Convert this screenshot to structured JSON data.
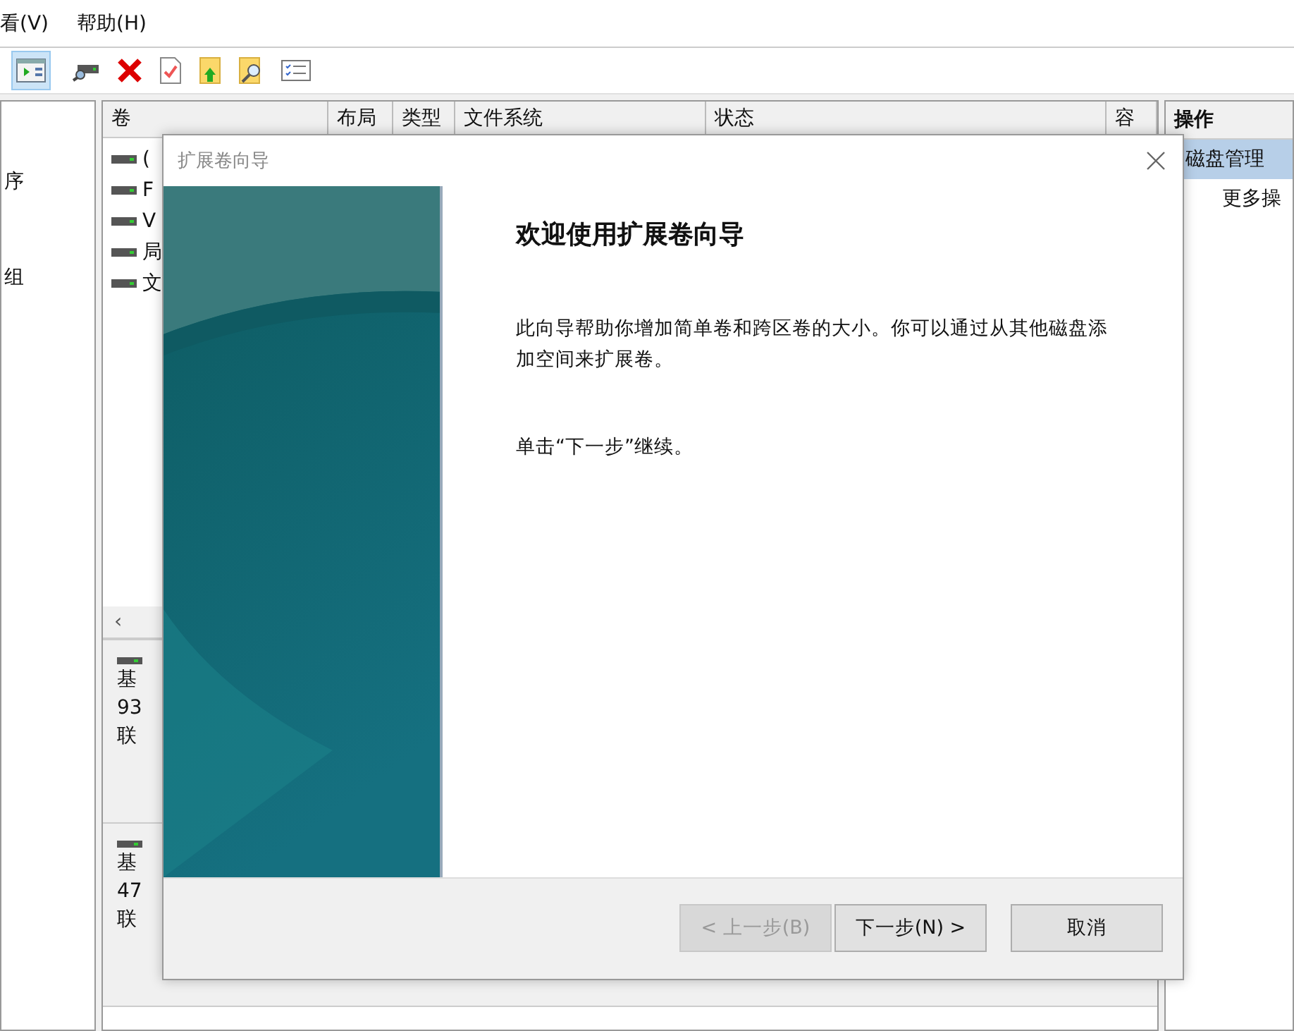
{
  "menu": [
    "看(V)",
    "帮助(H)"
  ],
  "toolbar": [
    {
      "kind": "view",
      "pressed": true
    },
    {
      "kind": "connect"
    },
    {
      "kind": "delete"
    },
    {
      "kind": "check"
    },
    {
      "kind": "up"
    },
    {
      "kind": "find"
    },
    {
      "kind": "list"
    }
  ],
  "scroll_left": "‹",
  "tree": [
    "序",
    "组"
  ],
  "table": {
    "columns": [
      "卷",
      "布局",
      "类型",
      "文件系统",
      "状态",
      "容"
    ],
    "rows": [
      {
        "label": "("
      },
      {
        "label": "F"
      },
      {
        "label": "V"
      },
      {
        "label": "局"
      },
      {
        "label": "文"
      }
    ]
  },
  "disks": [
    {
      "lines": [
        "基",
        "93",
        "联"
      ]
    },
    {
      "lines": [
        "基",
        "47",
        "联"
      ]
    }
  ],
  "actions": {
    "header": "操作",
    "items": [
      {
        "label": "磁盘管理",
        "selected": true
      },
      {
        "label": "更多操",
        "selected": false
      }
    ]
  },
  "dialog": {
    "title": "扩展卷向导",
    "heading": "欢迎使用扩展卷向导",
    "paragraphs": [
      "此向导帮助你增加简单卷和跨区卷的大小。你可以通过从其他磁盘添加空间来扩展卷。",
      "单击“下一步”继续。"
    ],
    "buttons": [
      {
        "label": "< 上一步(B)",
        "disabled": true
      },
      {
        "label": "下一步(N) >",
        "disabled": false
      },
      {
        "label": "取消",
        "disabled": false
      }
    ]
  }
}
